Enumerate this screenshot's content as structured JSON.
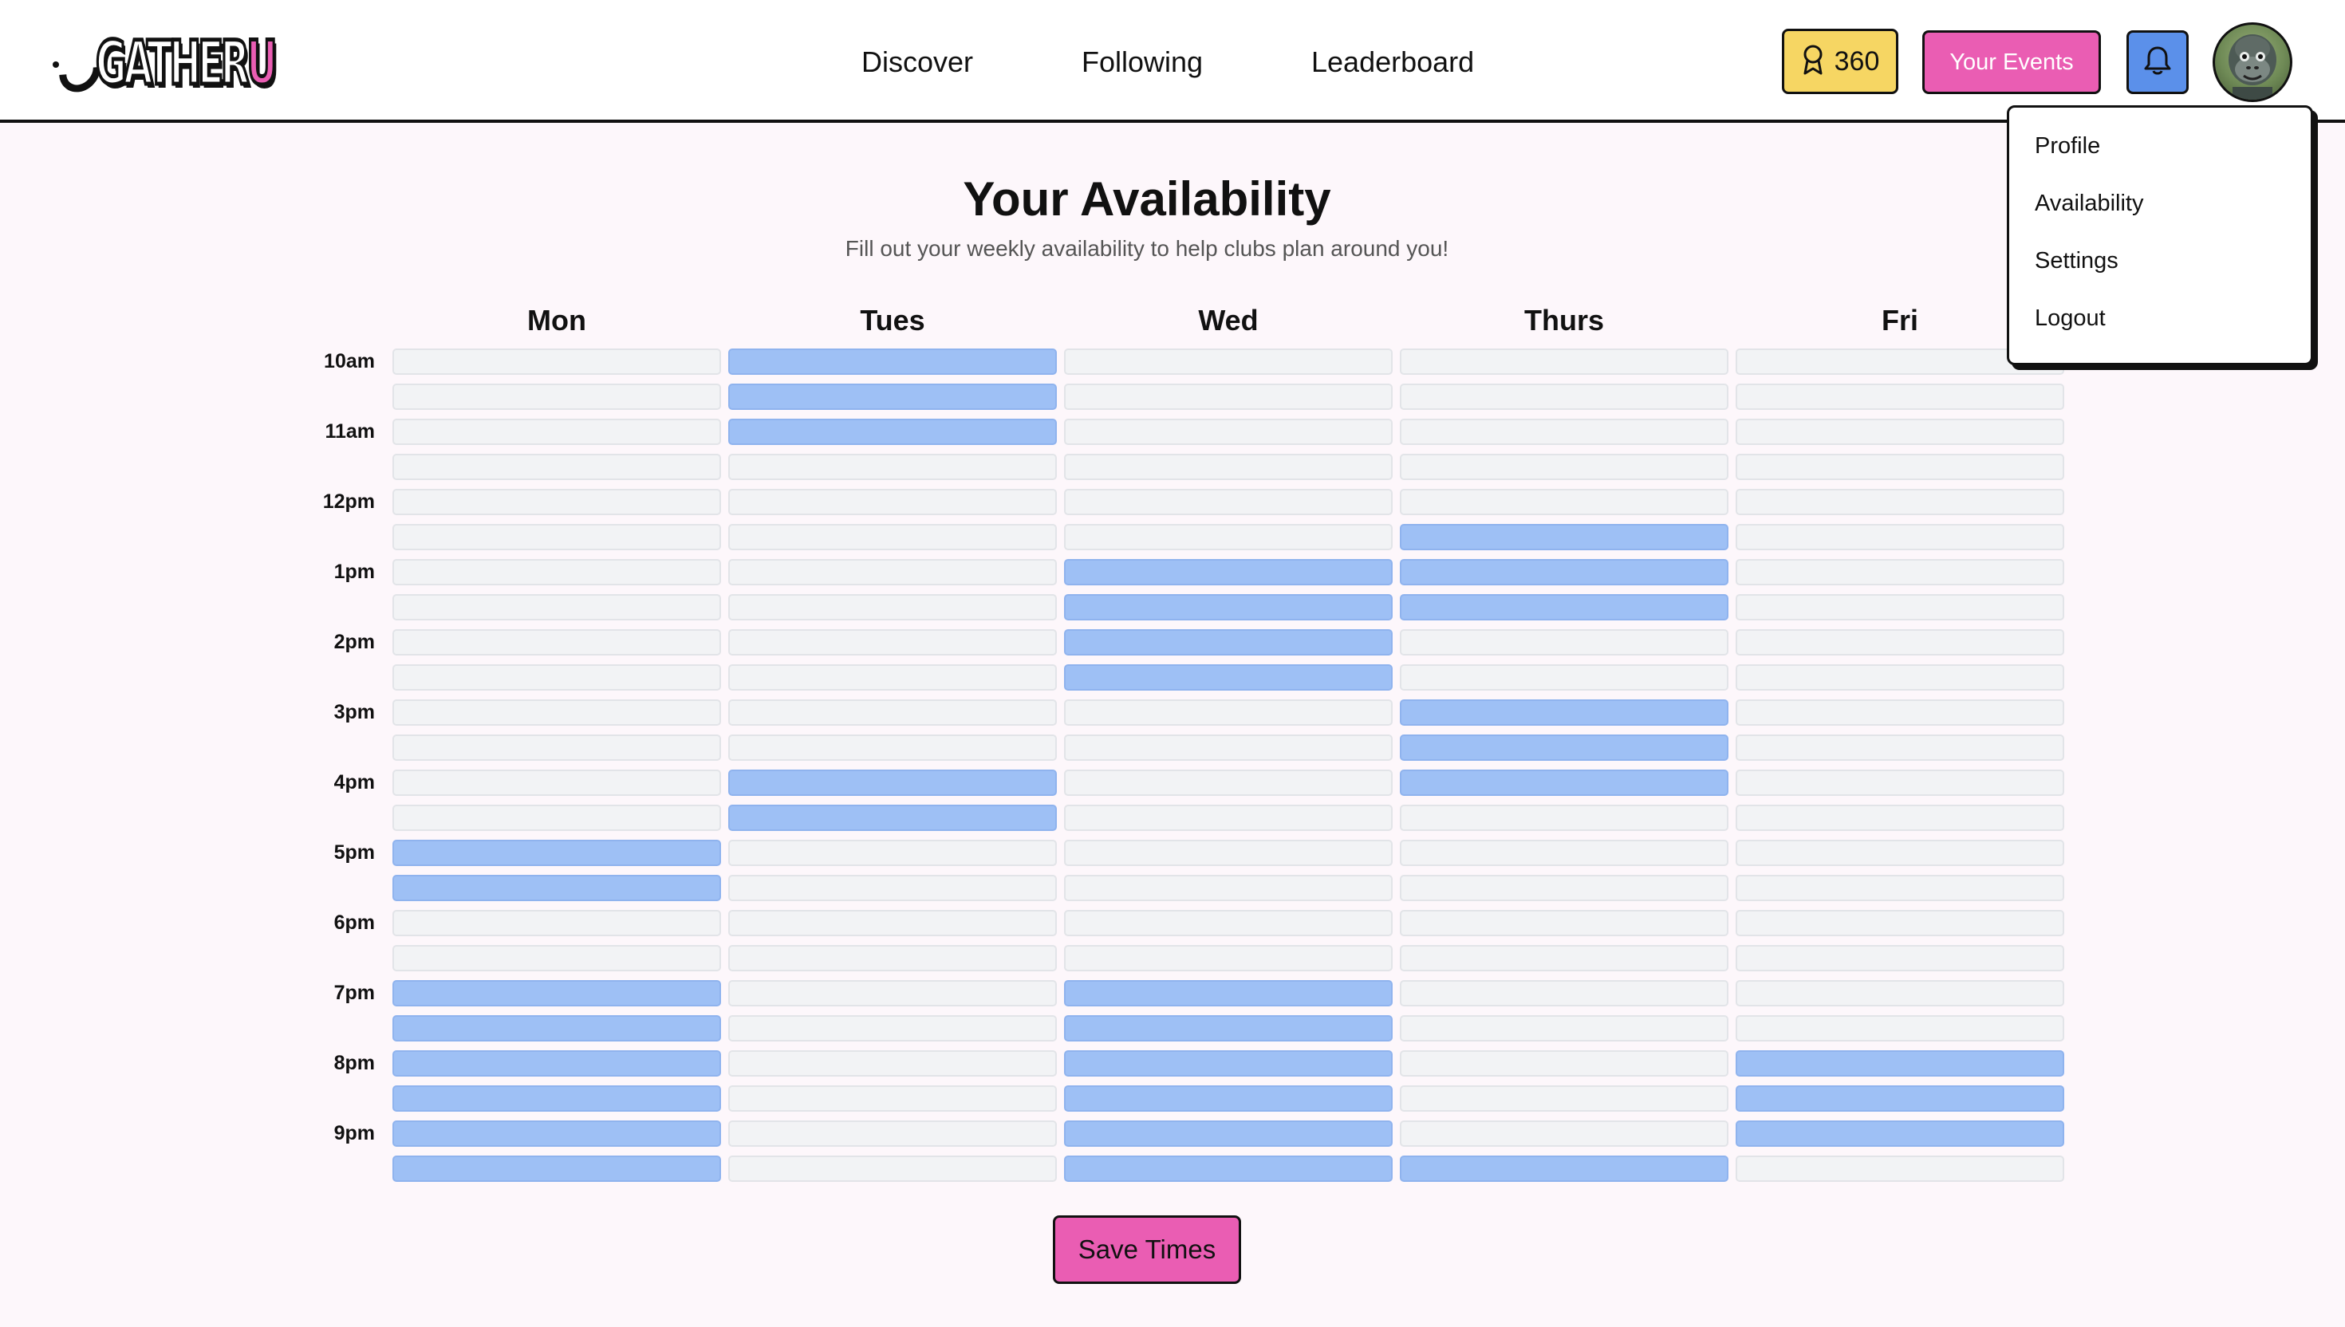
{
  "header": {
    "logo_text": "GATHERU",
    "logo_main": "GATHER",
    "logo_accent": "U",
    "nav": [
      {
        "label": "Discover"
      },
      {
        "label": "Following"
      },
      {
        "label": "Leaderboard"
      }
    ],
    "points": "360",
    "your_events_label": "Your Events",
    "icons": {
      "points": "award-ribbon-icon",
      "notifications": "bell-icon",
      "avatar": "gorilla-avatar"
    }
  },
  "user_menu": {
    "items": [
      {
        "label": "Profile"
      },
      {
        "label": "Availability"
      },
      {
        "label": "Settings"
      },
      {
        "label": "Logout"
      }
    ]
  },
  "main": {
    "title": "Your Availability",
    "subtitle": "Fill out your weekly availability to help clubs plan around you!",
    "save_label": "Save Times"
  },
  "availability": {
    "days": [
      "Mon",
      "Tues",
      "Wed",
      "Thurs",
      "Fri"
    ],
    "hour_labels": [
      "10am",
      "11am",
      "12pm",
      "1pm",
      "2pm",
      "3pm",
      "4pm",
      "5pm",
      "6pm",
      "7pm",
      "8pm",
      "9pm"
    ],
    "slots_per_hour": 2,
    "selected": {
      "Mon": [
        14,
        15,
        18,
        19,
        20,
        21,
        22,
        23
      ],
      "Tues": [
        0,
        1,
        2,
        12,
        13
      ],
      "Wed": [
        6,
        7,
        8,
        9,
        18,
        19,
        20,
        21,
        22,
        23
      ],
      "Thurs": [
        5,
        6,
        7,
        10,
        11,
        12,
        23
      ],
      "Fri": [
        20,
        21,
        22
      ]
    }
  },
  "colors": {
    "accent_pink": "#ea5db3",
    "points_yellow": "#f6d663",
    "bell_blue": "#5b90ea",
    "selected_cell": "#9ec0f5",
    "empty_cell": "#f2f3f5",
    "page_background": "#fdf7fb"
  }
}
